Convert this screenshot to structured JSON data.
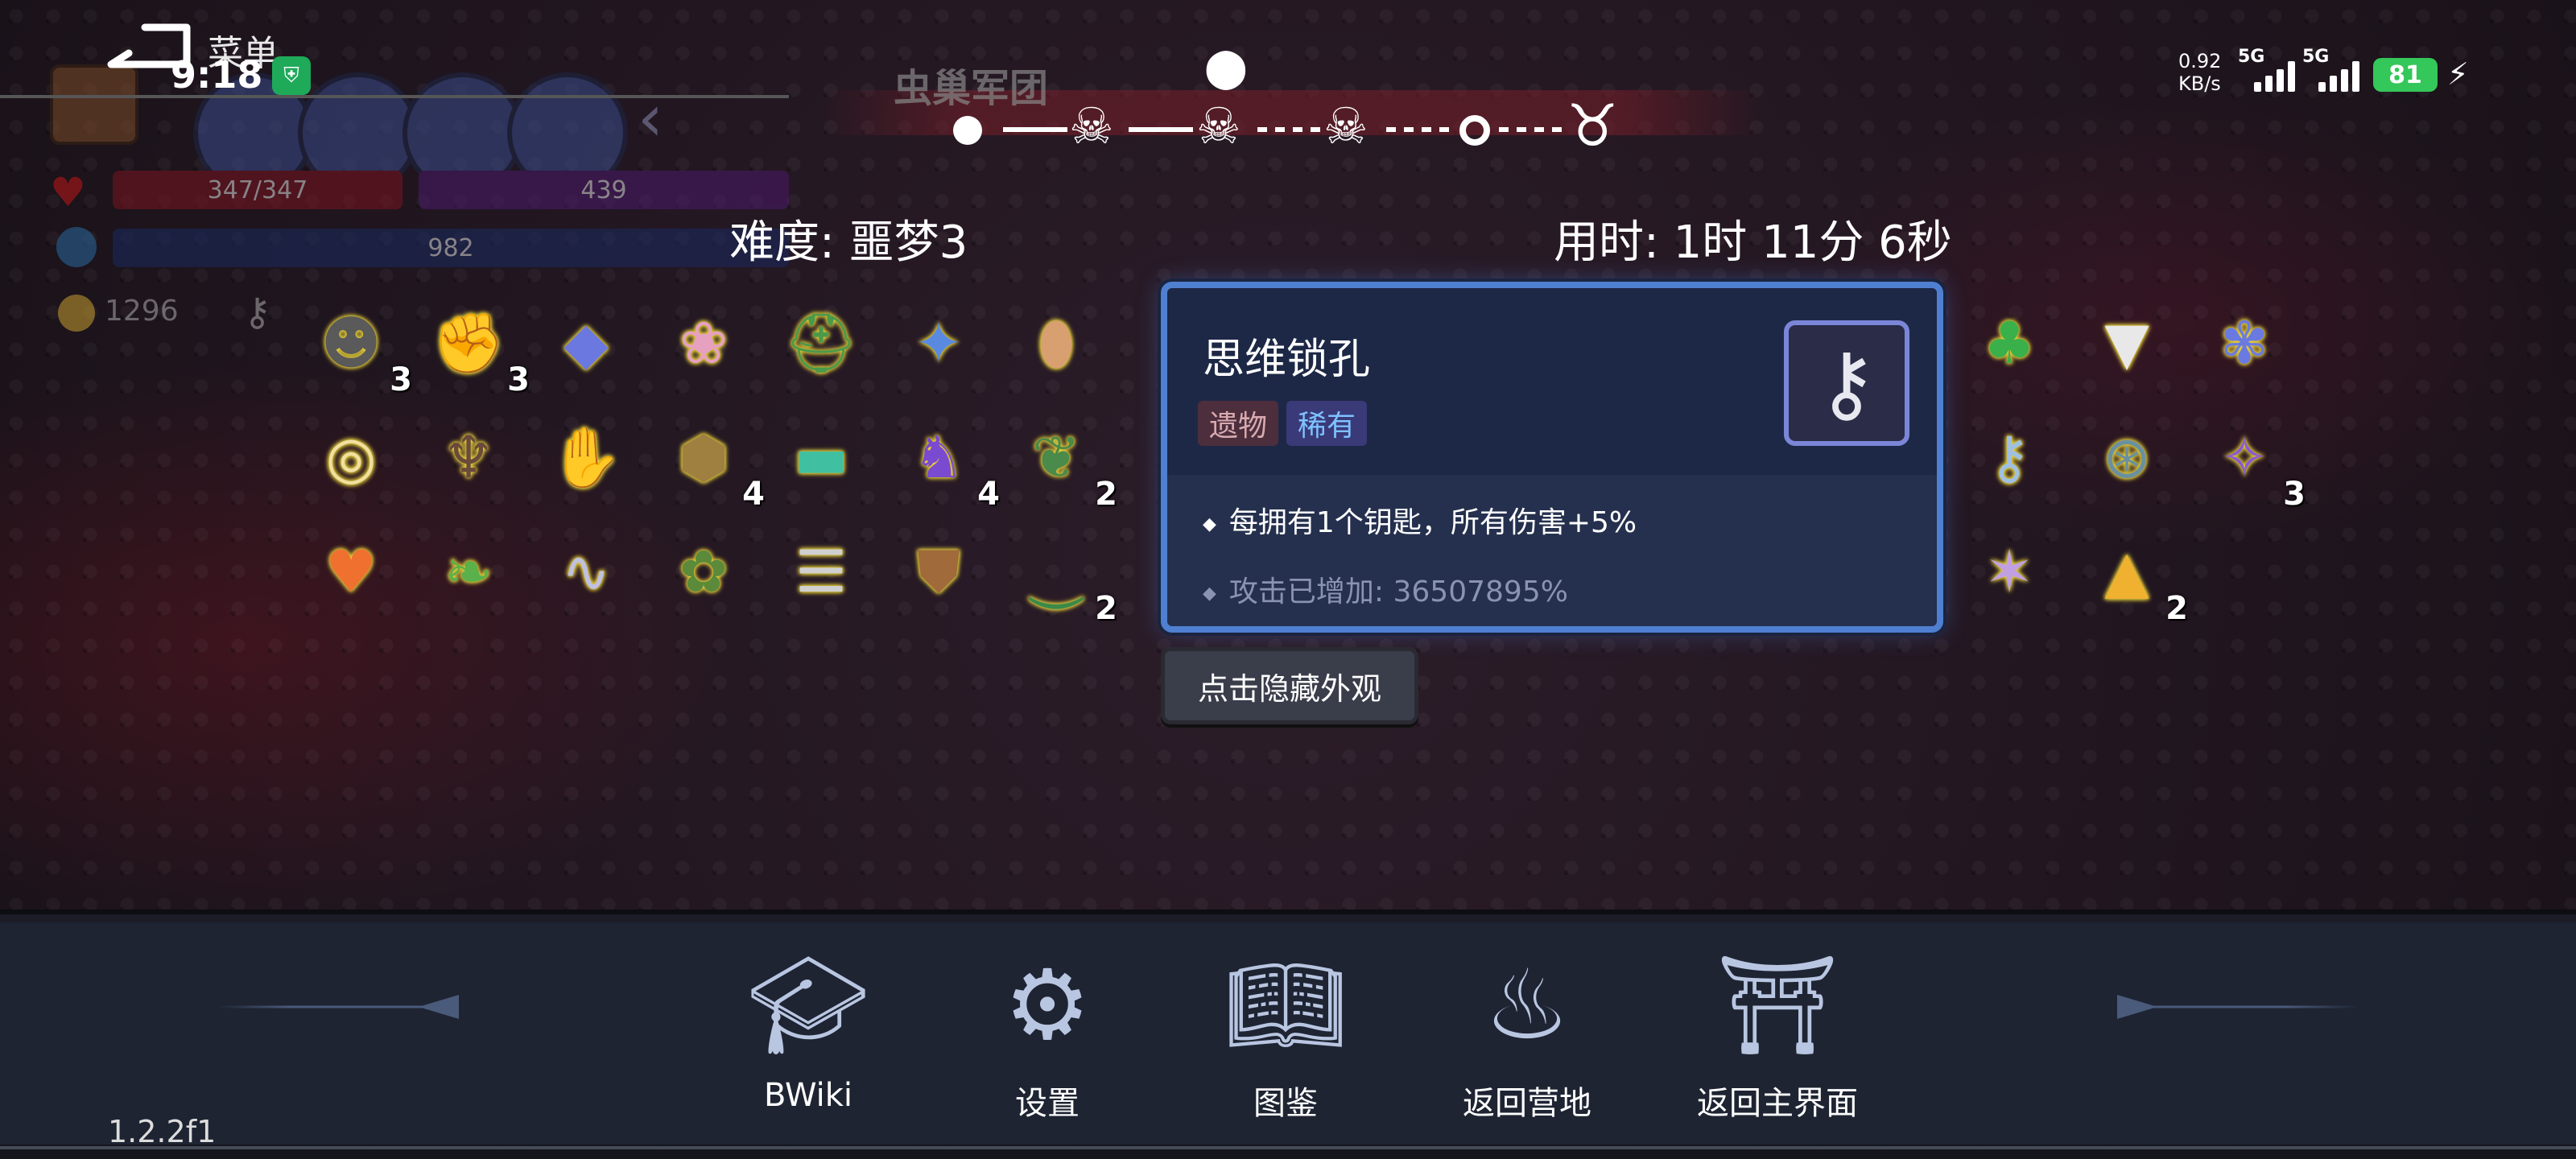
{
  "status_bar": {
    "menu_label": "菜单",
    "time": "9:18",
    "net_speed_value": "0.92",
    "net_speed_unit": "KB/s",
    "signal1": "5G",
    "signal2": "5G",
    "battery": "81"
  },
  "hud": {
    "hp": "347/347",
    "shield": "439",
    "mana": "982",
    "gold": "1296"
  },
  "progress": {
    "boss_name": "虫巢军团",
    "nodes": [
      "dot",
      "skull",
      "skull",
      "skull",
      "ring",
      "horned-skull"
    ]
  },
  "run_info": {
    "difficulty": "难度: 噩梦3",
    "elapsed": "用时: 1时 11分 6秒"
  },
  "items_left": [
    {
      "icon": "plague-mask",
      "glyph": "☻",
      "color": "#5a5a5a",
      "count": "3"
    },
    {
      "icon": "gauntlet",
      "glyph": "✊",
      "color": "#b26a2a",
      "count": "3"
    },
    {
      "icon": "crystal",
      "glyph": "◆",
      "color": "#6a78e0",
      "count": ""
    },
    {
      "icon": "brain",
      "glyph": "❀",
      "color": "#e6a0c0",
      "count": ""
    },
    {
      "icon": "hat",
      "glyph": "⛑",
      "color": "#4a9a4a",
      "count": ""
    },
    {
      "icon": "orb-amulet",
      "glyph": "✦",
      "color": "#5a8ae0",
      "count": ""
    },
    {
      "icon": "egg",
      "glyph": "⬮",
      "color": "#d8a070",
      "count": ""
    },
    {
      "icon": "glasses",
      "glyph": "◎",
      "color": "#f0e0a0",
      "count": ""
    },
    {
      "icon": "bat-wings",
      "glyph": "♆",
      "color": "#6a4a3a",
      "count": ""
    },
    {
      "icon": "claw-glove",
      "glyph": "✋",
      "color": "#4a6ab0",
      "count": ""
    },
    {
      "icon": "dice-box",
      "glyph": "⬢",
      "color": "#a08040",
      "count": "4"
    },
    {
      "icon": "rainbow-belt",
      "glyph": "▬",
      "color": "#40c0a0",
      "count": ""
    },
    {
      "icon": "purple-boot",
      "glyph": "♞",
      "color": "#7a4ad0",
      "count": "4"
    },
    {
      "icon": "leaf-pendant",
      "glyph": "❦",
      "color": "#4a8a4a",
      "count": "2"
    },
    {
      "icon": "heart",
      "glyph": "♥",
      "color": "#f07030",
      "count": ""
    },
    {
      "icon": "leaves",
      "glyph": "❧",
      "color": "#5ab04a",
      "count": ""
    },
    {
      "icon": "ribbon",
      "glyph": "∿",
      "color": "#c0c0e0",
      "count": ""
    },
    {
      "icon": "carnivorous-plant",
      "glyph": "✿",
      "color": "#5a8a3a",
      "count": ""
    },
    {
      "icon": "ribcage",
      "glyph": "☰",
      "color": "#d0d0d0",
      "count": ""
    },
    {
      "icon": "shield-charm",
      "glyph": "⛊",
      "color": "#a06a3a",
      "count": ""
    },
    {
      "icon": "green-belt",
      "glyph": "⏝",
      "color": "#3a8a4a",
      "count": "2"
    }
  ],
  "items_right": [
    {
      "icon": "clover",
      "glyph": "♣",
      "color": "#3ab04a",
      "count": ""
    },
    {
      "icon": "fangs",
      "glyph": "▼",
      "color": "#e8e8e8",
      "count": ""
    },
    {
      "icon": "lotus",
      "glyph": "✾",
      "color": "#6a7ae0",
      "count": ""
    },
    {
      "icon": "ornate-key",
      "glyph": "⚷",
      "color": "#a0c0e0",
      "count": ""
    },
    {
      "icon": "compass",
      "glyph": "⊛",
      "color": "#6a90a0",
      "count": ""
    },
    {
      "icon": "star-cube",
      "glyph": "✧",
      "color": "#8a5ad0",
      "count": "3"
    },
    {
      "icon": "crystal-shard",
      "glyph": "✶",
      "color": "#c0a0e0",
      "count": ""
    },
    {
      "icon": "candy-corn",
      "glyph": "▲",
      "color": "#f0b030",
      "count": "2"
    }
  ],
  "tooltip": {
    "title": "思维锁孔",
    "tag_relic": "遗物",
    "tag_rare": "稀有",
    "effect": "每拥有1个钥匙，所有伤害+5%",
    "bonus": "攻击已增加: 36507895%"
  },
  "hide_button": "点击隐藏外观",
  "nav": {
    "bwiki": "BWiki",
    "settings": "设置",
    "codex": "图鉴",
    "return_camp": "返回营地",
    "return_main": "返回主界面"
  },
  "version": "1.2.2f1"
}
